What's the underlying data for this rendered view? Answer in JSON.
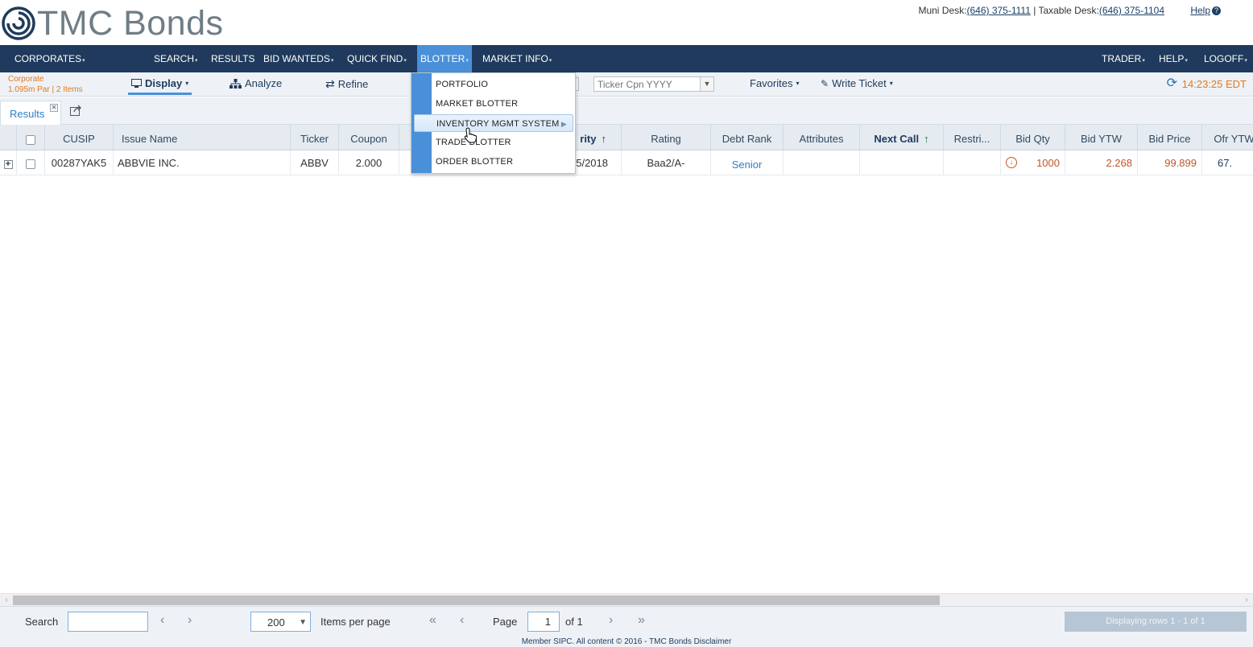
{
  "header": {
    "logo_text": "TMC Bonds",
    "muni_desk_label": "Muni Desk:",
    "muni_desk_phone": "(646) 375-1111",
    "separator": " | ",
    "taxable_desk_label": "Taxable Desk:",
    "taxable_desk_phone": "(646) 375-1104",
    "help_label": "Help"
  },
  "nav": {
    "corporates": "CORPORATES",
    "search": "SEARCH",
    "results": "RESULTS",
    "bid_wanteds": "BID WANTEDS",
    "quick_find": "QUICK FIND",
    "blotter": "BLOTTER",
    "market_info": "MARKET INFO",
    "trader": "TRADER",
    "help": "HELP",
    "logoff": "LOGOFF"
  },
  "toolbar": {
    "info_title": "Corporate",
    "info_sub": "1.095m Par | 2 Items",
    "display": "Display",
    "analyze": "Analyze",
    "refine": "Refine",
    "ticker_placeholder": "Ticker Cpn YYYY",
    "favorites": "Favorites",
    "write_ticket": "Write Ticket",
    "time": "14:23:25 EDT"
  },
  "tabs": {
    "results": "Results"
  },
  "blotter_menu": {
    "items": [
      {
        "label": "PORTFOLIO"
      },
      {
        "label": "MARKET BLOTTER"
      },
      {
        "label": "INVENTORY MGMT SYSTEM",
        "has_submenu": true
      },
      {
        "label": "TRADE BLOTTER"
      },
      {
        "label": "ORDER BLOTTER"
      }
    ]
  },
  "grid": {
    "columns": [
      "CUSIP",
      "Issue Name",
      "Ticker",
      "Coupon",
      "rity",
      "Rating",
      "Debt Rank",
      "Attributes",
      "Next Call",
      "Restri...",
      "Bid Qty",
      "Bid YTW",
      "Bid Price",
      "Ofr YTW"
    ],
    "rows": [
      {
        "cusip": "00287YAK5",
        "issue_name": "ABBVIE INC.",
        "ticker": "ABBV",
        "coupon": "2.000",
        "maturity_partial": "5/2018",
        "rating": "Baa2/A-",
        "debt_rank": "Senior",
        "attributes": "",
        "next_call": "",
        "restrictions": "",
        "bid_qty": "1000",
        "bid_ytw": "2.268",
        "bid_price": "99.899",
        "ofr_ytw": "67."
      }
    ]
  },
  "pager": {
    "search_label": "Search",
    "search_value": "",
    "items_per_page_value": "200",
    "items_per_page_label": "Items per page",
    "page_label": "Page",
    "page_value": "1",
    "of_label": "of 1",
    "display_rows": "Displaying rows 1 - 1 of 1"
  },
  "footer": {
    "text": "Member SIPC. All content © 2016 - TMC Bonds  Disclaimer"
  },
  "colors": {
    "nav_bg": "#1f3a5c",
    "accent_blue": "#4a90d9",
    "orange": "#e07a1f",
    "bid_orange": "#c0572a"
  }
}
